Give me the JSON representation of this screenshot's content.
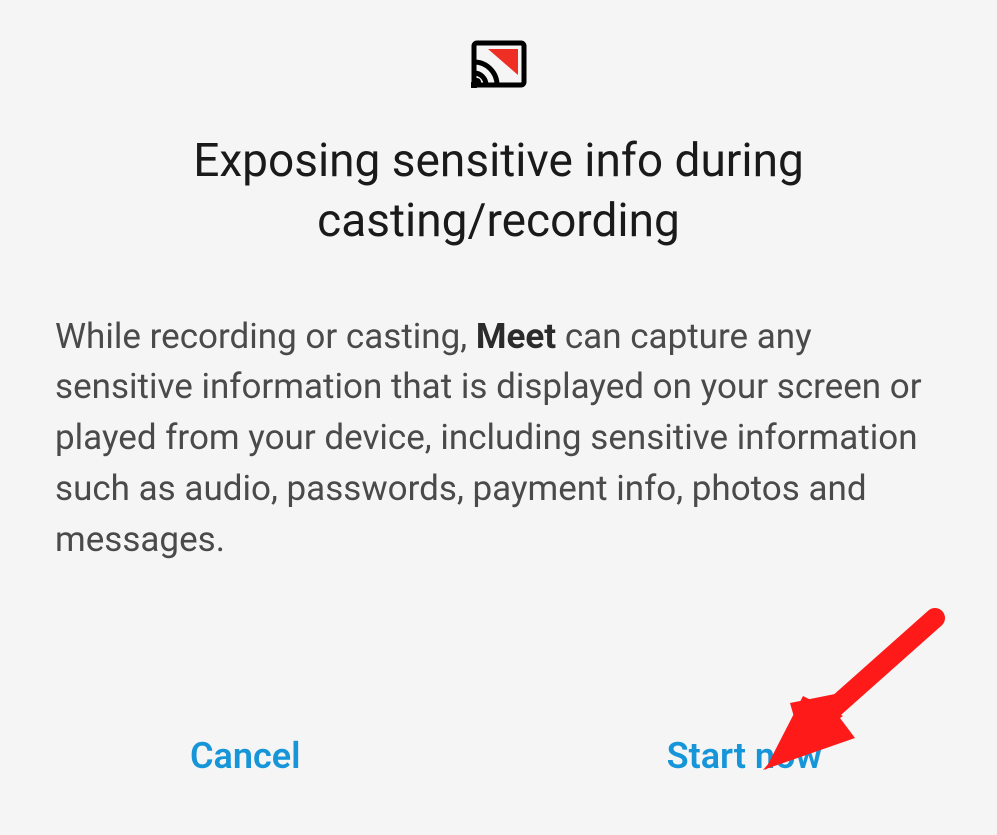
{
  "dialog": {
    "title": "Exposing sensitive info during casting/recording",
    "body_pre": "While recording or casting, ",
    "body_app": "Meet",
    "body_post": " can capture any sensitive information that is displayed on your screen or played from your device, including sensitive information such as audio, passwords, payment info, photos and messages.",
    "cancel_label": "Cancel",
    "confirm_label": "Start now"
  },
  "icon": {
    "name": "cast-recording-icon"
  },
  "annotation": {
    "type": "arrow",
    "color": "#ff1a1a",
    "points_to": "start-now-button"
  }
}
